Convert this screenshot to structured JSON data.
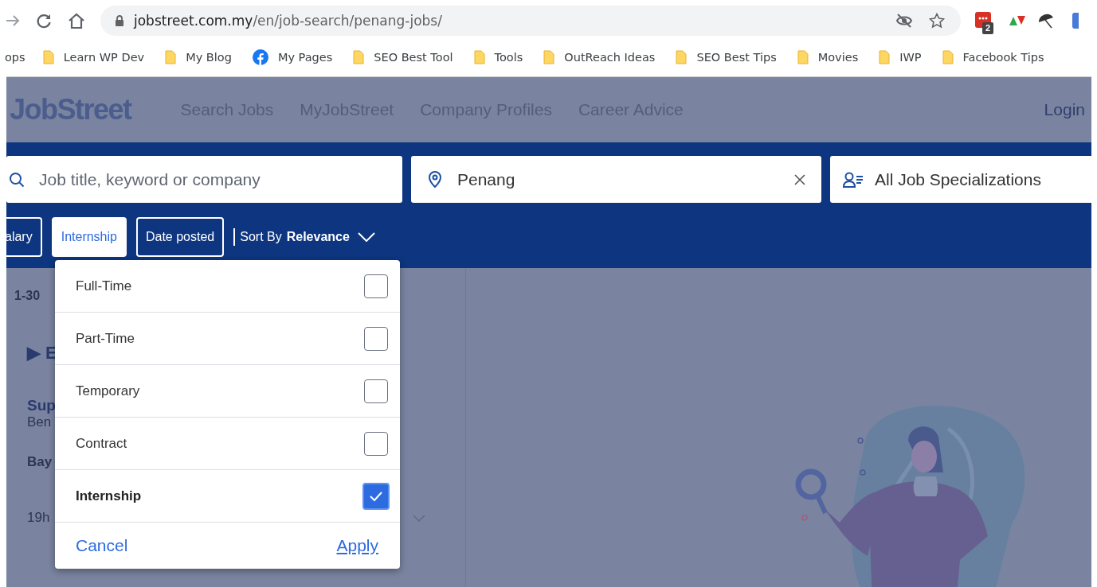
{
  "browser": {
    "url_host": "jobstreet.com.my",
    "url_path": "/en/job-search/penang-jobs/",
    "extension_badge": "2",
    "bookmarks": [
      {
        "label": "ops",
        "kind": "apps"
      },
      {
        "label": "Learn WP Dev",
        "kind": "folder"
      },
      {
        "label": "My Blog",
        "kind": "folder"
      },
      {
        "label": "My Pages",
        "kind": "facebook"
      },
      {
        "label": "SEO Best Tool",
        "kind": "folder"
      },
      {
        "label": "Tools",
        "kind": "folder"
      },
      {
        "label": "OutReach Ideas",
        "kind": "folder"
      },
      {
        "label": "SEO Best Tips",
        "kind": "folder"
      },
      {
        "label": "Movies",
        "kind": "folder"
      },
      {
        "label": "IWP",
        "kind": "folder"
      },
      {
        "label": "Facebook Tips",
        "kind": "folder"
      }
    ]
  },
  "header": {
    "logo": "JobStreet",
    "nav": [
      "Search Jobs",
      "MyJobStreet",
      "Company Profiles",
      "Career Advice"
    ],
    "login": "Login"
  },
  "search": {
    "keyword_placeholder": "Job title, keyword or company",
    "location": "Penang",
    "specialization": "All Job Specializations"
  },
  "filters": [
    {
      "label": "alary",
      "selected": false
    },
    {
      "label": "Internship",
      "selected": true
    },
    {
      "label": "Date posted",
      "selected": false
    }
  ],
  "sort": {
    "prefix": "Sort By",
    "value": "Relevance"
  },
  "results": {
    "count": "1-30",
    "section": "▶ E",
    "job_title": "Sup",
    "company": "Ben",
    "location": "Bay",
    "posted": "19h"
  },
  "job_type_menu": {
    "options": [
      {
        "label": "Full-Time",
        "checked": false
      },
      {
        "label": "Part-Time",
        "checked": false
      },
      {
        "label": "Temporary",
        "checked": false
      },
      {
        "label": "Contract",
        "checked": false
      },
      {
        "label": "Internship",
        "checked": true
      }
    ],
    "cancel": "Cancel",
    "apply": "Apply"
  }
}
